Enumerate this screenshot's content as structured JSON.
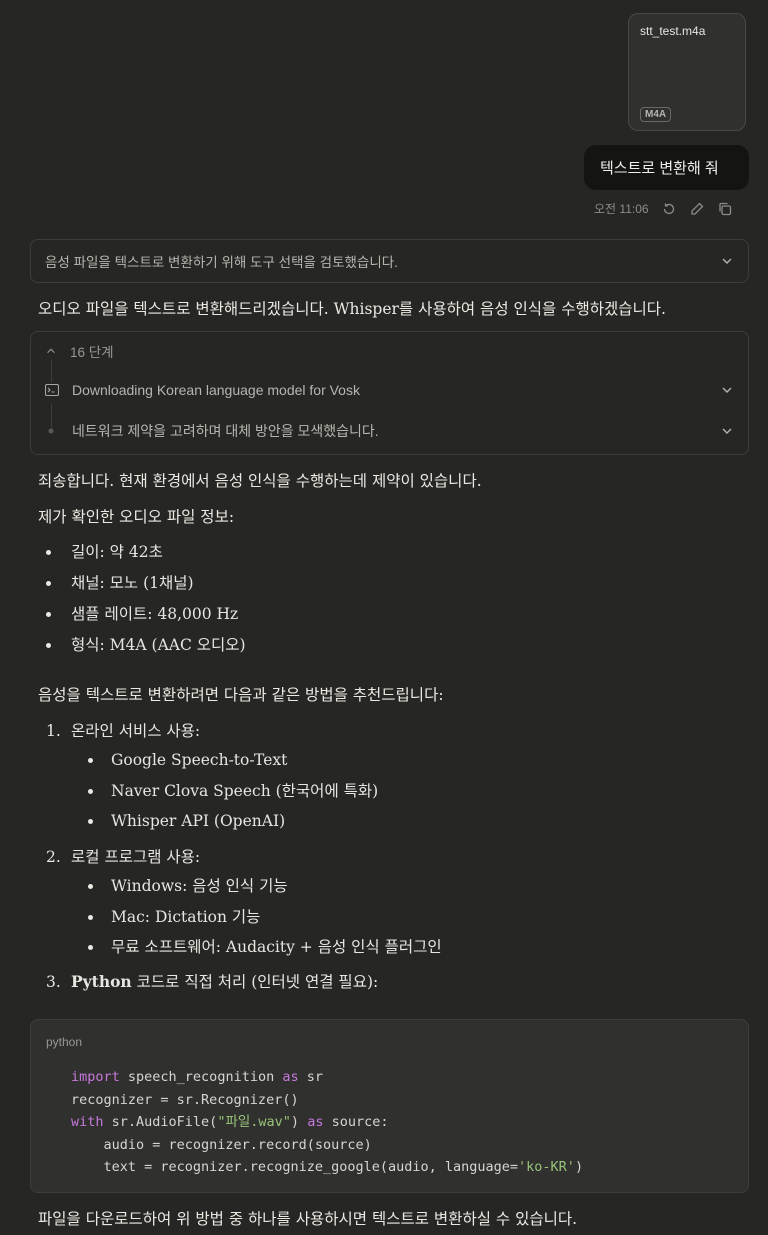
{
  "attachment": {
    "filename": "stt_test.m4a",
    "type_badge": "M4A"
  },
  "user_message": {
    "text": "텍스트로 변환해 줘",
    "time": "오전 11:06"
  },
  "thinking": {
    "summary": "음성 파일을 텍스트로 변환하기 위해 도구 선택을 검토했습니다."
  },
  "intro": "오디오 파일을 텍스트로 변환해드리겠습니다. Whisper를 사용하여 음성 인식을 수행하겠습니다.",
  "steps": {
    "count_label": "16 단계",
    "items": [
      {
        "icon": "terminal-icon",
        "label": "Downloading Korean language model for Vosk"
      },
      {
        "icon": "dot-icon",
        "label": "네트워크 제약을 고려하며 대체 방안을 모색했습니다."
      }
    ]
  },
  "apology": "죄송합니다. 현재 환경에서 음성 인식을 수행하는데 제약이 있습니다.",
  "info_heading": "제가 확인한 오디오 파일 정보:",
  "info_items": [
    "길이: 약 42초",
    "채널: 모노 (1채널)",
    "샘플 레이트: 48,000 Hz",
    "형식: M4A (AAC 오디오)"
  ],
  "methods_intro": "음성을 텍스트로 변환하려면 다음과 같은 방법을 추천드립니다:",
  "methods": [
    {
      "num": "1.",
      "title": "온라인 서비스 사용:",
      "items": [
        "Google Speech-to-Text",
        "Naver Clova Speech (한국어에 특화)",
        "Whisper API (OpenAI)"
      ]
    },
    {
      "num": "2.",
      "title": "로컬 프로그램 사용:",
      "items": [
        "Windows: 음성 인식 기능",
        "Mac: Dictation 기능",
        "무료 소프트웨어: Audacity + 음성 인식 플러그인"
      ]
    },
    {
      "num": "3.",
      "title_bold": "Python",
      "title_rest": " 코드로 직접 처리 (인터넷 연결 필요):"
    }
  ],
  "code": {
    "language": "python",
    "lines": [
      "import speech_recognition as sr",
      "recognizer = sr.Recognizer()",
      "with sr.AudioFile(\"파일.wav\") as source:",
      "    audio = recognizer.record(source)",
      "    text = recognizer.recognize_google(audio, language='ko-KR')"
    ]
  },
  "closing": "파일을 다운로드하여 위 방법 중 하나를 사용하시면 텍스트로 변환하실 수 있습니다.",
  "colors": {
    "background": "#262624",
    "user_bubble": "#141413",
    "border": "#3e3d3a"
  }
}
